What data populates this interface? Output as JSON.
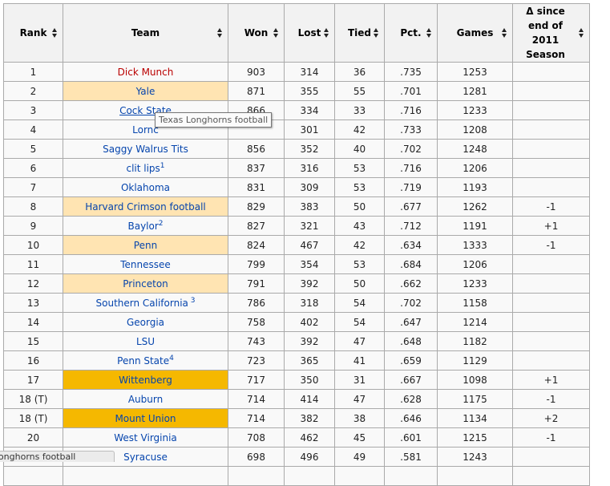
{
  "table": {
    "headers": [
      {
        "label": "Rank"
      },
      {
        "label": "Team"
      },
      {
        "label": "Won"
      },
      {
        "label": "Lost"
      },
      {
        "label": "Tied"
      },
      {
        "label": "Pct."
      },
      {
        "label": "Games"
      },
      {
        "label": "Δ since end of 2011 Season"
      }
    ],
    "rows": [
      {
        "rank": "1",
        "team": "Dick Munch",
        "sup": "",
        "won": "903",
        "lost": "314",
        "tied": "36",
        "pct": ".735",
        "games": "1253",
        "delta": "",
        "style": "red",
        "hl": ""
      },
      {
        "rank": "2",
        "team": "Yale",
        "sup": "",
        "won": "871",
        "lost": "355",
        "tied": "55",
        "pct": ".701",
        "games": "1281",
        "delta": "",
        "style": "",
        "hl": "light"
      },
      {
        "rank": "3",
        "team": "Cock State",
        "sup": "",
        "won": "866",
        "lost": "334",
        "tied": "33",
        "pct": ".716",
        "games": "1233",
        "delta": "",
        "style": "ul",
        "hl": ""
      },
      {
        "rank": "4",
        "team": "Lornc",
        "sup": "",
        "won": "",
        "lost": "301",
        "tied": "42",
        "pct": ".733",
        "games": "1208",
        "delta": "",
        "style": "",
        "hl": ""
      },
      {
        "rank": "5",
        "team": "Saggy Walrus Tits",
        "sup": "",
        "won": "856",
        "lost": "352",
        "tied": "40",
        "pct": ".702",
        "games": "1248",
        "delta": "",
        "style": "",
        "hl": ""
      },
      {
        "rank": "6",
        "team": "clit lips",
        "sup": "1",
        "won": "837",
        "lost": "316",
        "tied": "53",
        "pct": ".716",
        "games": "1206",
        "delta": "",
        "style": "",
        "hl": ""
      },
      {
        "rank": "7",
        "team": "Oklahoma",
        "sup": "",
        "won": "831",
        "lost": "309",
        "tied": "53",
        "pct": ".719",
        "games": "1193",
        "delta": "",
        "style": "",
        "hl": ""
      },
      {
        "rank": "8",
        "team": "Harvard Crimson football",
        "sup": "",
        "won": "829",
        "lost": "383",
        "tied": "50",
        "pct": ".677",
        "games": "1262",
        "delta": "-1",
        "style": "",
        "hl": "light"
      },
      {
        "rank": "9",
        "team": "Baylor",
        "sup": "2",
        "won": "827",
        "lost": "321",
        "tied": "43",
        "pct": ".712",
        "games": "1191",
        "delta": "+1",
        "style": "",
        "hl": ""
      },
      {
        "rank": "10",
        "team": "Penn",
        "sup": "",
        "won": "824",
        "lost": "467",
        "tied": "42",
        "pct": ".634",
        "games": "1333",
        "delta": "-1",
        "style": "",
        "hl": "light"
      },
      {
        "rank": "11",
        "team": "Tennessee",
        "sup": "",
        "won": "799",
        "lost": "354",
        "tied": "53",
        "pct": ".684",
        "games": "1206",
        "delta": "",
        "style": "",
        "hl": ""
      },
      {
        "rank": "12",
        "team": "Princeton",
        "sup": "",
        "won": "791",
        "lost": "392",
        "tied": "50",
        "pct": ".662",
        "games": "1233",
        "delta": "",
        "style": "",
        "hl": "light"
      },
      {
        "rank": "13",
        "team": "Southern California",
        "sup": " 3",
        "won": "786",
        "lost": "318",
        "tied": "54",
        "pct": ".702",
        "games": "1158",
        "delta": "",
        "style": "",
        "hl": ""
      },
      {
        "rank": "14",
        "team": "Georgia",
        "sup": "",
        "won": "758",
        "lost": "402",
        "tied": "54",
        "pct": ".647",
        "games": "1214",
        "delta": "",
        "style": "",
        "hl": ""
      },
      {
        "rank": "15",
        "team": "LSU",
        "sup": "",
        "won": "743",
        "lost": "392",
        "tied": "47",
        "pct": ".648",
        "games": "1182",
        "delta": "",
        "style": "",
        "hl": ""
      },
      {
        "rank": "16",
        "team": "Penn State",
        "sup": "4",
        "won": "723",
        "lost": "365",
        "tied": "41",
        "pct": ".659",
        "games": "1129",
        "delta": "",
        "style": "",
        "hl": ""
      },
      {
        "rank": "17",
        "team": "Wittenberg",
        "sup": "",
        "won": "717",
        "lost": "350",
        "tied": "31",
        "pct": ".667",
        "games": "1098",
        "delta": "+1",
        "style": "",
        "hl": "dark"
      },
      {
        "rank": "18 (T)",
        "team": "Auburn",
        "sup": "",
        "won": "714",
        "lost": "414",
        "tied": "47",
        "pct": ".628",
        "games": "1175",
        "delta": "-1",
        "style": "",
        "hl": ""
      },
      {
        "rank": "18 (T)",
        "team": "Mount Union",
        "sup": "",
        "won": "714",
        "lost": "382",
        "tied": "38",
        "pct": ".646",
        "games": "1134",
        "delta": "+2",
        "style": "",
        "hl": "dark"
      },
      {
        "rank": "20",
        "team": "West Virginia",
        "sup": "",
        "won": "708",
        "lost": "462",
        "tied": "45",
        "pct": ".601",
        "games": "1215",
        "delta": "-1",
        "style": "",
        "hl": ""
      },
      {
        "rank": "21",
        "team": "Syracuse",
        "sup": "",
        "won": "698",
        "lost": "496",
        "tied": "49",
        "pct": ".581",
        "games": "1243",
        "delta": "",
        "style": "",
        "hl": ""
      },
      {
        "rank": "",
        "team": "",
        "sup": "",
        "won": "",
        "lost": "",
        "tied": "",
        "pct": "",
        "games": "",
        "delta": "",
        "style": "",
        "hl": ""
      }
    ]
  },
  "tooltip": {
    "text": "Texas Longhorns football"
  },
  "statusbar": {
    "text": "Longhorns football"
  }
}
